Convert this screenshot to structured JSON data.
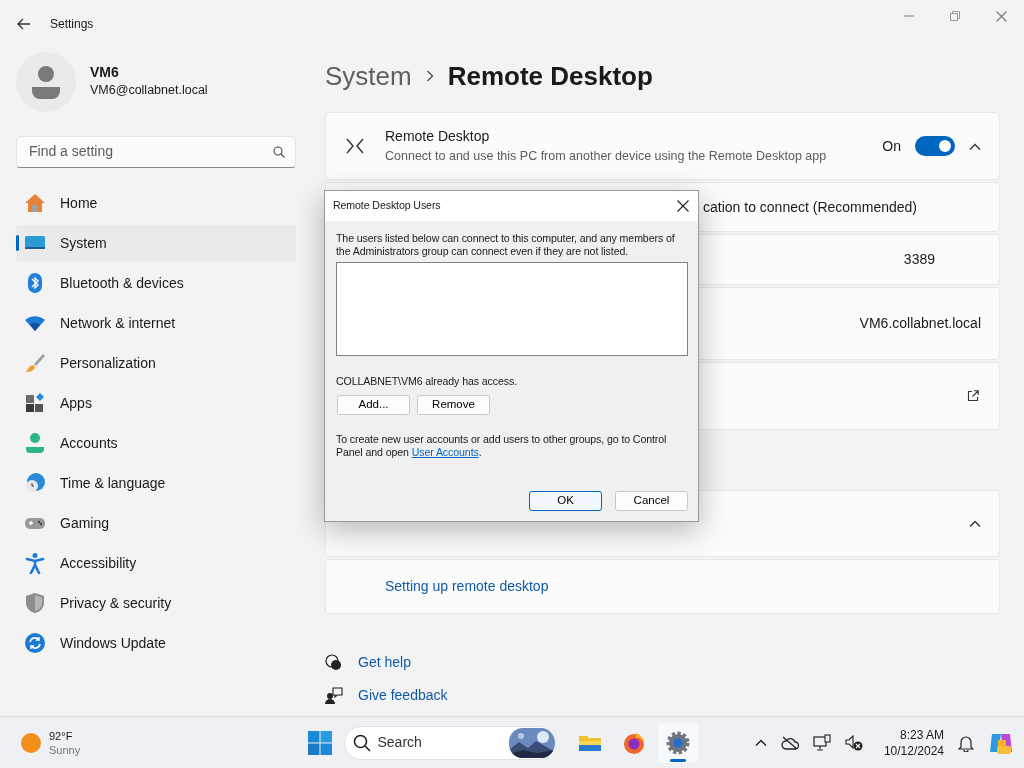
{
  "window": {
    "title": "Settings"
  },
  "user": {
    "name": "VM6",
    "email": "VM6@collabnet.local"
  },
  "search": {
    "placeholder": "Find a setting"
  },
  "sidebar": {
    "items": [
      {
        "label": "Home",
        "selected": false
      },
      {
        "label": "System",
        "selected": true
      },
      {
        "label": "Bluetooth & devices",
        "selected": false
      },
      {
        "label": "Network & internet",
        "selected": false
      },
      {
        "label": "Personalization",
        "selected": false
      },
      {
        "label": "Apps",
        "selected": false
      },
      {
        "label": "Accounts",
        "selected": false
      },
      {
        "label": "Time & language",
        "selected": false
      },
      {
        "label": "Gaming",
        "selected": false
      },
      {
        "label": "Accessibility",
        "selected": false
      },
      {
        "label": "Privacy & security",
        "selected": false
      },
      {
        "label": "Windows Update",
        "selected": false
      }
    ]
  },
  "breadcrumb": {
    "parent": "System",
    "current": "Remote Desktop"
  },
  "remote_desktop": {
    "title": "Remote Desktop",
    "description": "Connect to and use this PC from another device using the Remote Desktop app",
    "state_label": "On",
    "on": true,
    "expanded": true
  },
  "settings_rows": [
    {
      "kind": "checkbox-text",
      "text": "cation to connect (Recommended)"
    },
    {
      "kind": "value",
      "text": "3389"
    },
    {
      "kind": "tall-value",
      "text": "VM6.collabnet.local"
    },
    {
      "kind": "link"
    }
  ],
  "help": {
    "expanded": true,
    "links": [
      "Setting up remote desktop"
    ]
  },
  "footer_links": [
    {
      "kind": "help",
      "label": "Get help"
    },
    {
      "kind": "feedback",
      "label": "Give feedback"
    }
  ],
  "dialog": {
    "title": "Remote Desktop Users",
    "intro": "The users listed below can connect to this computer, and any members of the Administrators group can connect even if they are not listed.",
    "status": "COLLABNET\\VM6 already has access.",
    "list_buttons": [
      {
        "label": "Add...",
        "default": false
      },
      {
        "label": "Remove",
        "default": false
      }
    ],
    "note": "To create new user accounts or add users to other groups, go to Control Panel and open ",
    "note_link": "User Accounts",
    "note_end": ".",
    "buttons": [
      {
        "label": "OK",
        "default": true
      },
      {
        "label": "Cancel",
        "default": false
      }
    ]
  },
  "taskbar": {
    "weather": {
      "temperature": "92°F",
      "condition": "Sunny"
    },
    "search": {
      "label": "Search"
    },
    "apps": [
      {
        "running": false
      },
      {
        "running": false
      },
      {
        "running": true
      }
    ],
    "clock": {
      "time": "8:23 AM",
      "date": "10/12/2024"
    }
  }
}
